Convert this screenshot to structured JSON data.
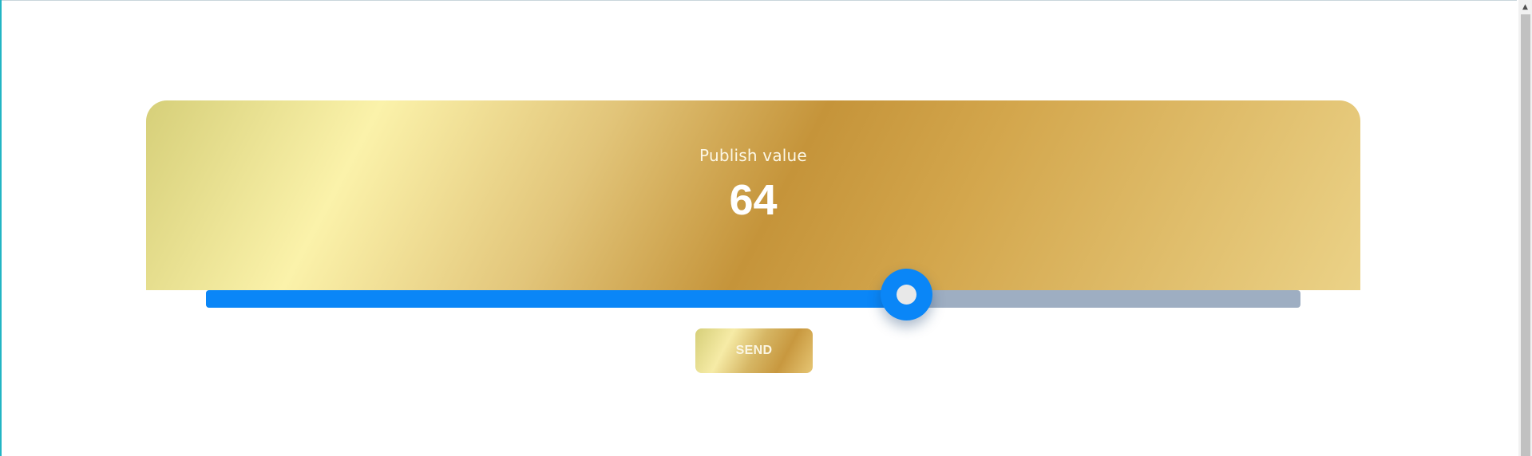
{
  "publish": {
    "title": "Publish value",
    "value": "64"
  },
  "slider": {
    "value": 64,
    "min": 0,
    "max": 100,
    "fill_color": "#0a86f7",
    "track_color": "#9eaec2"
  },
  "send_button": {
    "label": "SEND"
  },
  "colors": {
    "gold_light": "#fbf2aa",
    "gold_dark": "#c5943a",
    "accent": "#0a86f7"
  },
  "icons": {
    "scroll_up": "scroll-up-arrow-icon"
  }
}
